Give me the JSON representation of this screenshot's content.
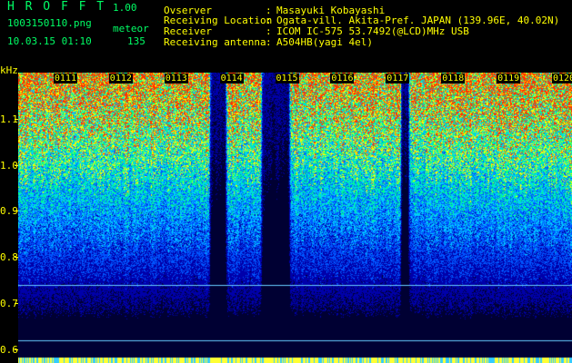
{
  "header": {
    "app_name": "H R O F F T",
    "version": "1.00",
    "filename": "1003150110.png",
    "mode": "meteor",
    "datetime": "10.03.15 01:10",
    "count": "135",
    "info_labels": [
      "Ovserver",
      "Receiving Location",
      "Receiver",
      "Receiving antenna"
    ],
    "info_values": [
      "Masayuki Kobayashi",
      "Ogata-vill. Akita-Pref. JAPAN (139.96E, 40.02N)",
      "ICOM IC-575 53.7492(@LCD)MHz USB",
      "A504HB(yagi 4el)"
    ]
  },
  "spectrogram": {
    "y_unit": "kHz",
    "y_ticks": [
      "1.1",
      "1.0",
      "0.9",
      "0.8",
      "0.7",
      "0.6"
    ],
    "y_tick_values": [
      1.1,
      1.0,
      0.9,
      0.8,
      0.7,
      0.6
    ],
    "y_range": [
      0.57,
      1.2
    ],
    "x_ticks": [
      "0111",
      "0112",
      "0113",
      "0114",
      "0115",
      "0116",
      "0117",
      "0118",
      "0119",
      "0120"
    ],
    "x_tick_minutes": [
      1,
      2,
      3,
      4,
      5,
      6,
      7,
      8,
      9,
      10
    ],
    "x_range_minutes": [
      0,
      10
    ],
    "horizontal_lines_khz": [
      0.74,
      0.62
    ],
    "dark_bands_minutes": [
      [
        3.45,
        3.75
      ],
      [
        4.4,
        4.9
      ],
      [
        6.9,
        7.05
      ]
    ],
    "palette": [
      "#000033",
      "#0000aa",
      "#0055ff",
      "#00ccff",
      "#00ff88",
      "#ffff00",
      "#ff3300"
    ]
  }
}
